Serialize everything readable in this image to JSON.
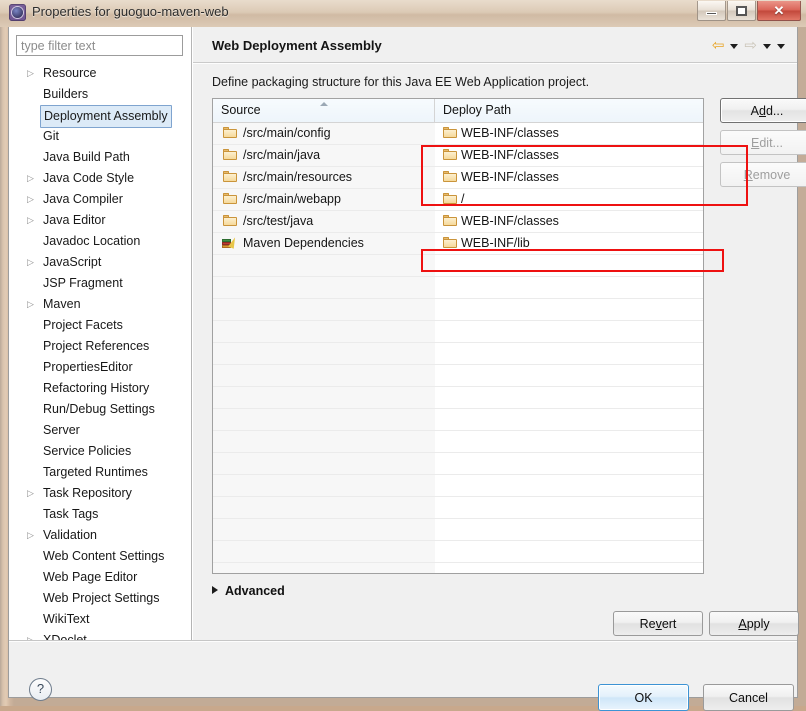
{
  "window": {
    "title": "Properties for guoguo-maven-web",
    "app_icon": "gear-icon",
    "controls": {
      "minimize": "minimize-icon",
      "maximize": "maximize-icon",
      "close": "✕"
    }
  },
  "sidebar": {
    "filter": {
      "value": "",
      "placeholder": "type filter text"
    },
    "items": [
      {
        "label": "Resource",
        "expandable": true,
        "selected": false
      },
      {
        "label": "Builders",
        "expandable": false,
        "selected": false
      },
      {
        "label": "Deployment Assembly",
        "expandable": false,
        "selected": true
      },
      {
        "label": "Git",
        "expandable": false,
        "selected": false
      },
      {
        "label": "Java Build Path",
        "expandable": false,
        "selected": false
      },
      {
        "label": "Java Code Style",
        "expandable": true,
        "selected": false
      },
      {
        "label": "Java Compiler",
        "expandable": true,
        "selected": false
      },
      {
        "label": "Java Editor",
        "expandable": true,
        "selected": false
      },
      {
        "label": "Javadoc Location",
        "expandable": false,
        "selected": false
      },
      {
        "label": "JavaScript",
        "expandable": true,
        "selected": false
      },
      {
        "label": "JSP Fragment",
        "expandable": false,
        "selected": false
      },
      {
        "label": "Maven",
        "expandable": true,
        "selected": false
      },
      {
        "label": "Project Facets",
        "expandable": false,
        "selected": false
      },
      {
        "label": "Project References",
        "expandable": false,
        "selected": false
      },
      {
        "label": "PropertiesEditor",
        "expandable": false,
        "selected": false
      },
      {
        "label": "Refactoring History",
        "expandable": false,
        "selected": false
      },
      {
        "label": "Run/Debug Settings",
        "expandable": false,
        "selected": false
      },
      {
        "label": "Server",
        "expandable": false,
        "selected": false
      },
      {
        "label": "Service Policies",
        "expandable": false,
        "selected": false
      },
      {
        "label": "Targeted Runtimes",
        "expandable": false,
        "selected": false
      },
      {
        "label": "Task Repository",
        "expandable": true,
        "selected": false
      },
      {
        "label": "Task Tags",
        "expandable": false,
        "selected": false
      },
      {
        "label": "Validation",
        "expandable": true,
        "selected": false
      },
      {
        "label": "Web Content Settings",
        "expandable": false,
        "selected": false
      },
      {
        "label": "Web Page Editor",
        "expandable": false,
        "selected": false
      },
      {
        "label": "Web Project Settings",
        "expandable": false,
        "selected": false
      },
      {
        "label": "WikiText",
        "expandable": false,
        "selected": false
      },
      {
        "label": "XDoclet",
        "expandable": true,
        "selected": false
      }
    ],
    "twisty_glyph": "▷"
  },
  "main": {
    "page_title": "Web Deployment Assembly",
    "description": "Define packaging structure for this Java EE Web Application project.",
    "nav": {
      "back": "⇦",
      "back_caret": "▾",
      "forward": "⇨",
      "forward_caret": "▾",
      "menu_caret": "▾"
    },
    "table": {
      "columns": [
        "Source",
        "Deploy Path"
      ],
      "sorted_column": "Source",
      "sort_direction": "ascending",
      "rows": [
        {
          "source": "/src/main/config",
          "source_icon": "folder-icon",
          "deploy": "WEB-INF/classes",
          "deploy_icon": "folder-icon"
        },
        {
          "source": "/src/main/java",
          "source_icon": "folder-icon",
          "deploy": "WEB-INF/classes",
          "deploy_icon": "folder-icon"
        },
        {
          "source": "/src/main/resources",
          "source_icon": "folder-icon",
          "deploy": "WEB-INF/classes",
          "deploy_icon": "folder-icon"
        },
        {
          "source": "/src/main/webapp",
          "source_icon": "folder-icon",
          "deploy": "/",
          "deploy_icon": "folder-icon"
        },
        {
          "source": "/src/test/java",
          "source_icon": "folder-icon",
          "deploy": "WEB-INF/classes",
          "deploy_icon": "folder-icon"
        },
        {
          "source": "Maven Dependencies",
          "source_icon": "books-icon",
          "deploy": "WEB-INF/lib",
          "deploy_icon": "folder-icon"
        }
      ],
      "empty_row_count": 16
    },
    "buttons": {
      "add": "Add...",
      "add_mnemonic": "d",
      "edit": "Edit...",
      "edit_mnemonic": "E",
      "remove": "Remove",
      "remove_mnemonic": "R",
      "edit_enabled": false,
      "remove_enabled": false
    },
    "advanced": {
      "label": "Advanced",
      "expanded": false
    },
    "footer_buttons": {
      "revert": "Revert",
      "apply": "Apply"
    }
  },
  "dialog_footer": {
    "help": "?",
    "ok": "OK",
    "cancel": "Cancel"
  },
  "colors": {
    "annotation": "#ee1111",
    "selection": "#dbeaf7",
    "selection_border": "#7da2ce",
    "header_tint": "#eef5fb",
    "ok_focus": "#3c93d4"
  }
}
